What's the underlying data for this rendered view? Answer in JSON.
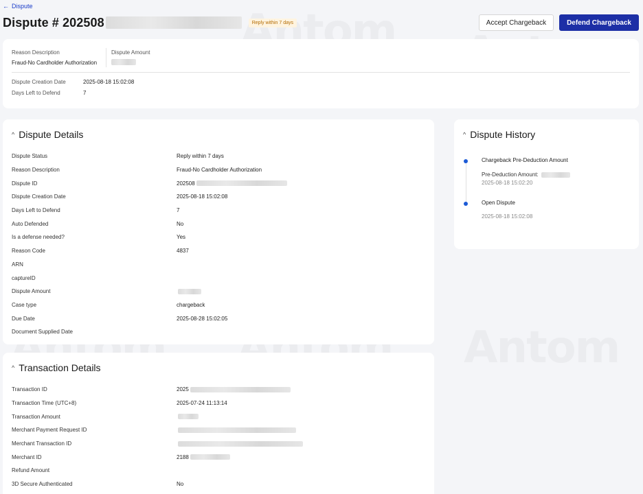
{
  "nav": {
    "back_label": "Dispute"
  },
  "header": {
    "title": "Dispute # 202508",
    "status_chip": "Reply within 7 days",
    "accept_label": "Accept Chargeback",
    "defend_label": "Defend Chargeback"
  },
  "summary": {
    "reason_label": "Reason Description",
    "reason_value": "Fraud-No Cardholder Authorization",
    "amount_label": "Dispute Amount",
    "creation_label": "Dispute Creation Date",
    "creation_value": "2025-08-18 15:02:08",
    "days_label": "Days Left to Defend",
    "days_value": "7"
  },
  "details": {
    "title": "Dispute Details",
    "rows": [
      {
        "k": "Dispute Status",
        "v": "Reply within 7 days"
      },
      {
        "k": "Reason Description",
        "v": "Fraud-No Cardholder Authorization"
      },
      {
        "k": "Dispute ID",
        "v": "202508"
      },
      {
        "k": "Dispute Creation Date",
        "v": "2025-08-18 15:02:08"
      },
      {
        "k": "Days Left to Defend",
        "v": "7"
      },
      {
        "k": "Auto Defended",
        "v": "No"
      },
      {
        "k": "Is a defense needed?",
        "v": "Yes"
      },
      {
        "k": "Reason Code",
        "v": "4837"
      },
      {
        "k": "ARN",
        "v": ""
      },
      {
        "k": "captureID",
        "v": ""
      },
      {
        "k": "Dispute Amount",
        "v": ""
      },
      {
        "k": "Case type",
        "v": "chargeback"
      },
      {
        "k": "Due Date",
        "v": "2025-08-28 15:02:05"
      },
      {
        "k": "Document Supplied Date",
        "v": ""
      }
    ]
  },
  "transaction": {
    "title": "Transaction Details",
    "rows": [
      {
        "k": "Transaction ID",
        "v": "2025"
      },
      {
        "k": "Transaction Time (UTC+8)",
        "v": "2025-07-24 11:13:14"
      },
      {
        "k": "Transaction Amount",
        "v": ""
      },
      {
        "k": "Merchant Payment Request ID",
        "v": ""
      },
      {
        "k": "Merchant Transaction ID",
        "v": ""
      },
      {
        "k": "Merchant ID",
        "v": "2188"
      },
      {
        "k": "Refund Amount",
        "v": ""
      },
      {
        "k": "3D Secure Authenticated",
        "v": "No"
      }
    ]
  },
  "history": {
    "title": "Dispute History",
    "events": [
      {
        "title": "Chargeback Pre-Deduction Amount",
        "sub": "Pre-Deduction Amount:",
        "date": "2025-08-18 15:02:20"
      },
      {
        "title": "Open Dispute",
        "sub": "",
        "date": "2025-08-18 15:02:08"
      }
    ]
  },
  "watermark": {
    "text": "Antom"
  },
  "colors": {
    "primary": "#1c2fa6",
    "link": "#1a3cc8",
    "chip_text": "#b36b00",
    "chip_bg": "#fff4e0",
    "dot": "#1c5bd6"
  },
  "icons": {
    "back": "arrow-left-icon",
    "collapse": "chevron-up-icon"
  }
}
